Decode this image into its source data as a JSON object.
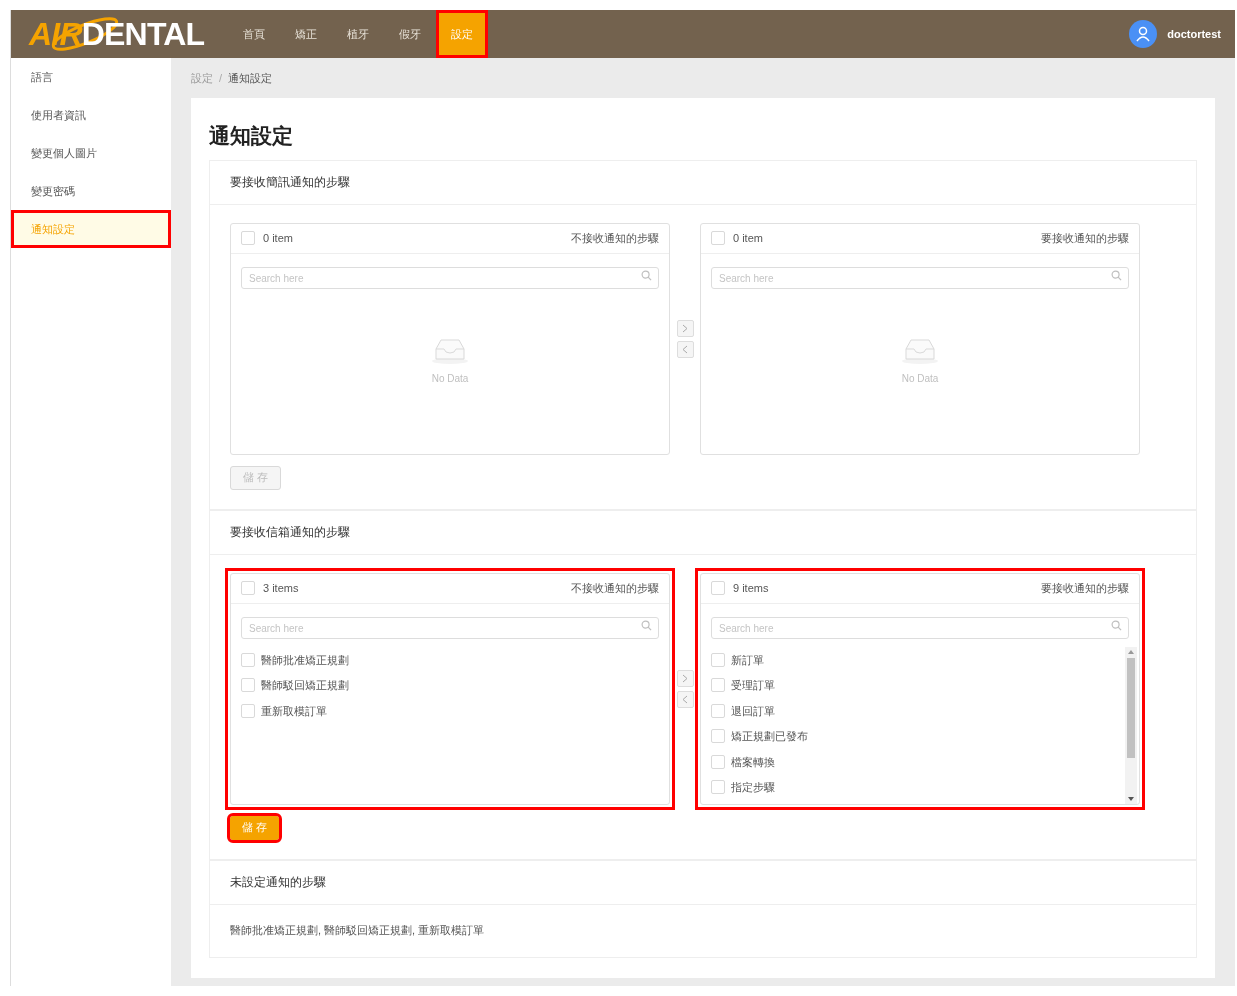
{
  "header": {
    "logo": {
      "accent": "AIR",
      "main": "DENTAL"
    },
    "nav": [
      {
        "label": "首頁",
        "selected": false,
        "annotated": false
      },
      {
        "label": "矯正",
        "selected": false,
        "annotated": false
      },
      {
        "label": "植牙",
        "selected": false,
        "annotated": false
      },
      {
        "label": "假牙",
        "selected": false,
        "annotated": false
      },
      {
        "label": "設定",
        "selected": true,
        "annotated": true
      }
    ],
    "user": {
      "name": "doctortest"
    }
  },
  "sidebar": {
    "items": [
      {
        "label": "語言",
        "selected": false,
        "annotated": false
      },
      {
        "label": "使用者資訊",
        "selected": false,
        "annotated": false
      },
      {
        "label": "變更個人圖片",
        "selected": false,
        "annotated": false
      },
      {
        "label": "變更密碼",
        "selected": false,
        "annotated": false
      },
      {
        "label": "通知設定",
        "selected": true,
        "annotated": true
      }
    ]
  },
  "breadcrumb": [
    "設定",
    "通知設定"
  ],
  "breadcrumb_separator": "/",
  "page_title": "通知設定",
  "sections": [
    {
      "kind": "transfer",
      "title": "要接收簡訊通知的步驟",
      "lists": [
        {
          "count": "0 item",
          "all_checked": false,
          "title": "不接收通知的步驟",
          "placeholder": "Search here",
          "empty_text": "No Data",
          "annotated": false
        },
        {
          "count": "0 item",
          "all_checked": false,
          "title": "要接收通知的步驟",
          "placeholder": "Search here",
          "empty_text": "No Data",
          "annotated": false
        }
      ],
      "save": {
        "label": "儲 存",
        "disabled": true,
        "annotated": false
      }
    },
    {
      "kind": "transfer",
      "title": "要接收信箱通知的步驟",
      "lists": [
        {
          "count": "3 items",
          "all_checked": false,
          "title": "不接收通知的步驟",
          "placeholder": "Search here",
          "annotated": true,
          "items": [
            {
              "label": "醫師批准矯正規劃",
              "checked": false
            },
            {
              "label": "醫師駁回矯正規劃",
              "checked": false
            },
            {
              "label": "重新取模訂單",
              "checked": false
            }
          ]
        },
        {
          "count": "9 items",
          "all_checked": false,
          "title": "要接收通知的步驟",
          "placeholder": "Search here",
          "annotated": true,
          "scrollable": true,
          "items": [
            {
              "label": "新訂單",
              "checked": false
            },
            {
              "label": "受理訂單",
              "checked": false
            },
            {
              "label": "退回訂單",
              "checked": false
            },
            {
              "label": "矯正規劃已發布",
              "checked": false
            },
            {
              "label": "檔案轉換",
              "checked": false
            },
            {
              "label": "指定步驟",
              "checked": false
            }
          ]
        }
      ],
      "save": {
        "label": "儲 存",
        "disabled": false,
        "annotated": true
      }
    },
    {
      "kind": "text",
      "title": "未設定通知的步驟",
      "text": "醫師批准矯正規劃, 醫師駁回矯正規劃, 重新取模訂單"
    }
  ]
}
